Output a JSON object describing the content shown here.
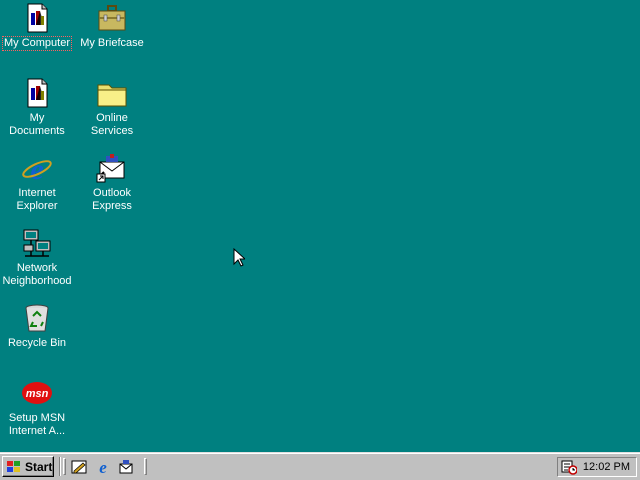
{
  "desktop": {
    "icons": [
      {
        "label": "My Computer",
        "icon": "my-computer-icon"
      },
      {
        "label": "My Briefcase",
        "icon": "briefcase-icon"
      },
      {
        "label": "My Documents",
        "icon": "my-documents-icon"
      },
      {
        "label": "Online Services",
        "icon": "folder-icon"
      },
      {
        "label": "Internet Explorer",
        "icon": "internet-explorer-icon"
      },
      {
        "label": "Outlook Express",
        "icon": "outlook-express-icon"
      },
      {
        "label": "Network Neighborhood",
        "icon": "network-neighborhood-icon"
      },
      {
        "label": "Recycle Bin",
        "icon": "recycle-bin-icon"
      },
      {
        "label": "Setup MSN Internet A...",
        "icon": "msn-icon"
      }
    ],
    "background_color": "#008080"
  },
  "taskbar": {
    "start_label": "Start",
    "quick_launch": [
      "show-desktop-icon",
      "internet-explorer-icon",
      "outlook-express-icon"
    ],
    "tray_icon": "scheduler-icon",
    "clock": "12:02 PM"
  }
}
